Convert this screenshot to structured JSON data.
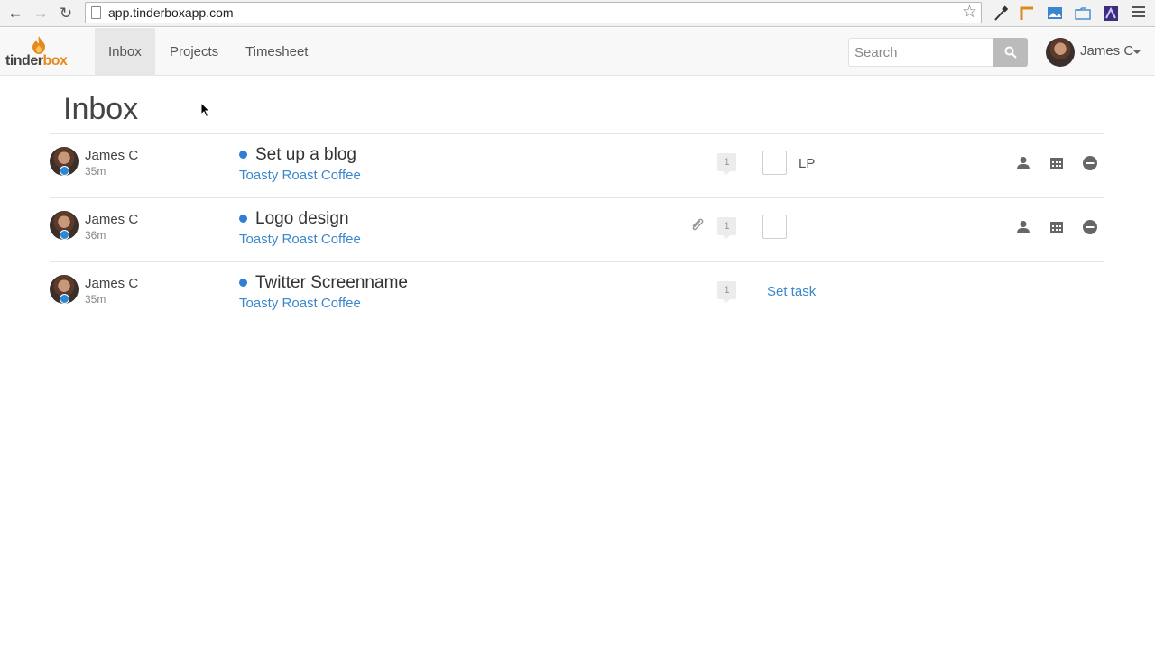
{
  "browser": {
    "url": "app.tinderboxapp.com"
  },
  "header": {
    "logo_text_main": "tinder",
    "logo_text_accent": "box",
    "tabs": [
      {
        "label": "Inbox",
        "active": true
      },
      {
        "label": "Projects",
        "active": false
      },
      {
        "label": "Timesheet",
        "active": false
      }
    ],
    "search_placeholder": "Search",
    "user_name": "James C"
  },
  "page": {
    "title": "Inbox"
  },
  "items": [
    {
      "author": "James C",
      "age": "35m",
      "title": "Set up a blog",
      "project": "Toasty Roast Coffee",
      "count": "1",
      "assignee": "LP"
    },
    {
      "author": "James C",
      "age": "36m",
      "title": "Logo design",
      "project": "Toasty Roast Coffee",
      "count": "1",
      "assignee": ""
    },
    {
      "author": "James C",
      "age": "35m",
      "title": "Twitter Screenname",
      "project": "Toasty Roast Coffee",
      "count": "1",
      "set_task": "Set task"
    }
  ],
  "colors": {
    "accent": "#3a87c9",
    "status_dot": "#2f7fd6",
    "logo_orange": "#e58a1f"
  },
  "icons": [
    "back-icon",
    "forward-icon",
    "reload-icon",
    "page-icon",
    "star-icon",
    "search-icon",
    "paperclip-icon",
    "person-icon",
    "calendar-icon",
    "minus-circle-icon",
    "hamburger-menu-icon"
  ]
}
